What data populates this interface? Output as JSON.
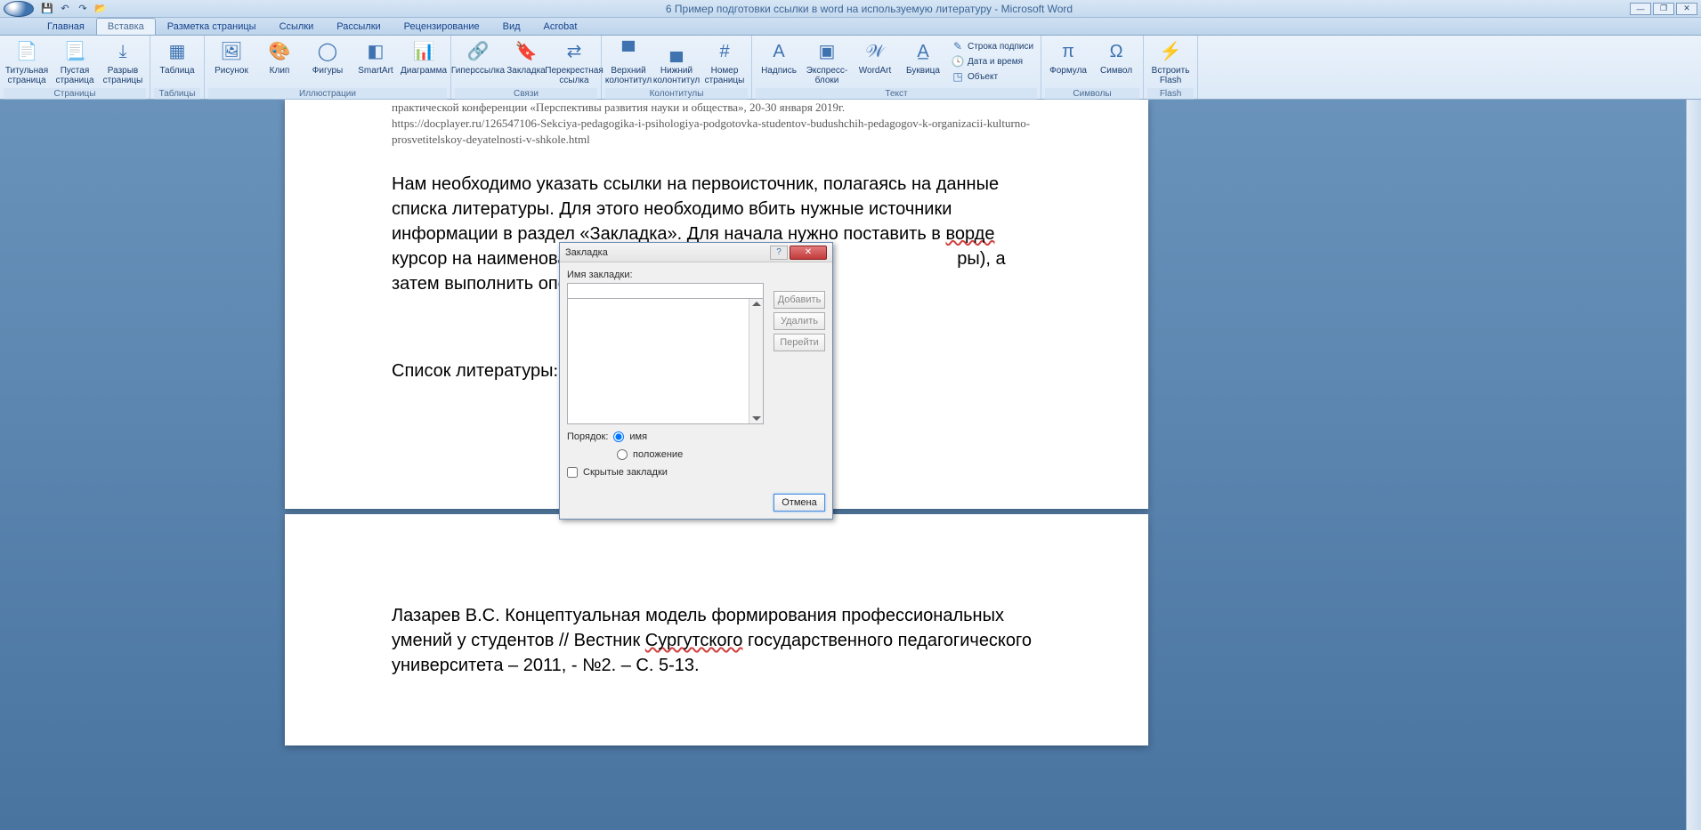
{
  "title": "6 Пример подготовки ссылки в word на используемую литературу - Microsoft Word",
  "qat": {
    "save": "💾",
    "undo": "↶",
    "redo": "↷",
    "open": "📂"
  },
  "win": {
    "min": "—",
    "restore": "❐",
    "close": "✕"
  },
  "tabs": [
    "Главная",
    "Вставка",
    "Разметка страницы",
    "Ссылки",
    "Рассылки",
    "Рецензирование",
    "Вид",
    "Acrobat"
  ],
  "groups": {
    "pages": {
      "title": "Страницы",
      "items": [
        "Титульная страница",
        "Пустая страница",
        "Разрыв страницы"
      ]
    },
    "tables": {
      "title": "Таблицы",
      "items": [
        "Таблица"
      ]
    },
    "illus": {
      "title": "Иллюстрации",
      "items": [
        "Рисунок",
        "Клип",
        "Фигуры",
        "SmartArt",
        "Диаграмма"
      ]
    },
    "links": {
      "title": "Связи",
      "items": [
        "Гиперссылка",
        "Закладка",
        "Перекрестная ссылка"
      ]
    },
    "headers": {
      "title": "Колонтитулы",
      "items": [
        "Верхний колонтитул",
        "Нижний колонтитул",
        "Номер страницы"
      ]
    },
    "text": {
      "title": "Текст",
      "items": [
        "Надпись",
        "Экспресс-блоки",
        "WordArt",
        "Буквица"
      ],
      "small": [
        "Строка подписи",
        "Дата и время",
        "Объект"
      ]
    },
    "symbols": {
      "title": "Символы",
      "items": [
        "Формула",
        "Символ"
      ]
    },
    "flash": {
      "title": "Flash",
      "items": [
        "Встроить Flash"
      ]
    }
  },
  "doc": {
    "partial1": "практической   конференции   «Перспективы   развития   науки   и   общества»,   20-30   января   2019г.",
    "url": "https://docplayer.ru/126547106-Sekciya-pedagogika-i-psihologiya-podgotovka-studentov-budushchih-pedagogov-k-organizacii-kulturno-prosvetitelskoy-deyatelnosti-v-shkole.html",
    "para1a": "Нам необходимо указать ссылки на первоисточник, полагаясь на данные списка литературы. Для этого необходимо вбить нужные источники информации в раздел «Закладка». Для начала нужно поставить в ",
    "para1b": " курсор на наименова",
    "para1c": "ры), а затем выполнить операцию: Вставка-",
    "word_vorde": "ворде",
    "biblist": "Список литературы",
    "p2_1": "Лазарев В.С. Концептуальная модель формирования профессиональных умений у студентов // Вестник ",
    "p2_sur": "Сургутского",
    "p2_2": " государственного педагогического университета – 2011, - №2. – С. 5-13."
  },
  "dialog": {
    "title": "Закладка",
    "label": "Имя закладки:",
    "order": "Порядок:",
    "opt_name": "имя",
    "opt_pos": "положение",
    "hidden": "Скрытые закладки",
    "add": "Добавить",
    "del": "Удалить",
    "go": "Перейти",
    "cancel": "Отмена",
    "help": "?"
  }
}
